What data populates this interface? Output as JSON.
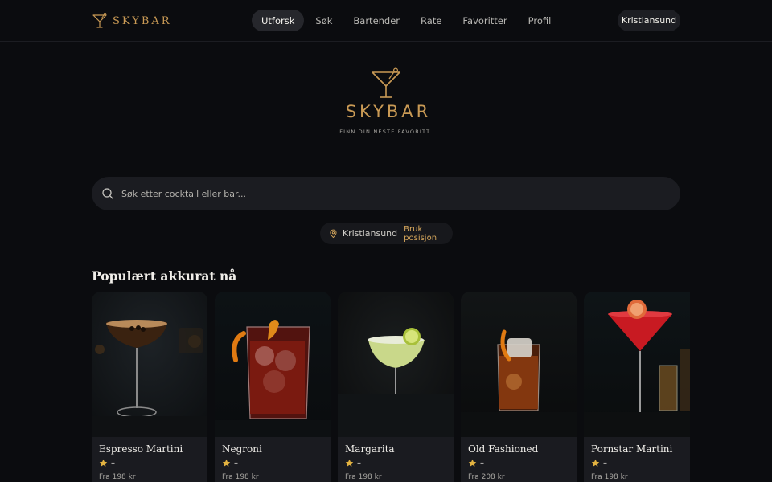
{
  "brand": {
    "name": "SKYBAR"
  },
  "nav": {
    "items": [
      {
        "label": "Utforsk",
        "active": true
      },
      {
        "label": "Søk",
        "active": false
      },
      {
        "label": "Bartender",
        "active": false
      },
      {
        "label": "Rate",
        "active": false
      },
      {
        "label": "Favoritter",
        "active": false
      },
      {
        "label": "Profil",
        "active": false
      }
    ],
    "city": "Kristiansund"
  },
  "hero": {
    "title": "SKYBAR",
    "tagline": "FINN DIN NESTE FAVORITT."
  },
  "search": {
    "placeholder": "Søk etter cocktail eller bar...",
    "value": "",
    "icon": "search-icon"
  },
  "location": {
    "city": "Kristiansund",
    "button": "Bruk posisjon",
    "icon": "location-pin-icon"
  },
  "popular": {
    "title": "Populært akkurat nå",
    "cards": [
      {
        "name": "Espresso Martini",
        "rating": "–",
        "price": "Fra 198 kr",
        "drink_color": "#3a2210",
        "glass": "coupe"
      },
      {
        "name": "Negroni",
        "rating": "–",
        "price": "Fra 198 kr",
        "drink_color": "#7a1a10",
        "glass": "rocks"
      },
      {
        "name": "Margarita",
        "rating": "–",
        "price": "Fra 198 kr",
        "drink_color": "#c9d88a",
        "glass": "coupe"
      },
      {
        "name": "Old Fashioned",
        "rating": "–",
        "price": "Fra 208 kr",
        "drink_color": "#8a3a10",
        "glass": "rocks"
      },
      {
        "name": "Pornstar Martini",
        "rating": "–",
        "price": "Fra 198 kr",
        "drink_color": "#c81a22",
        "glass": "martini"
      }
    ]
  },
  "colors": {
    "accent": "#c99a55",
    "background": "#0b0c0f",
    "surface": "#1a1b20",
    "star": "#e3b341"
  }
}
